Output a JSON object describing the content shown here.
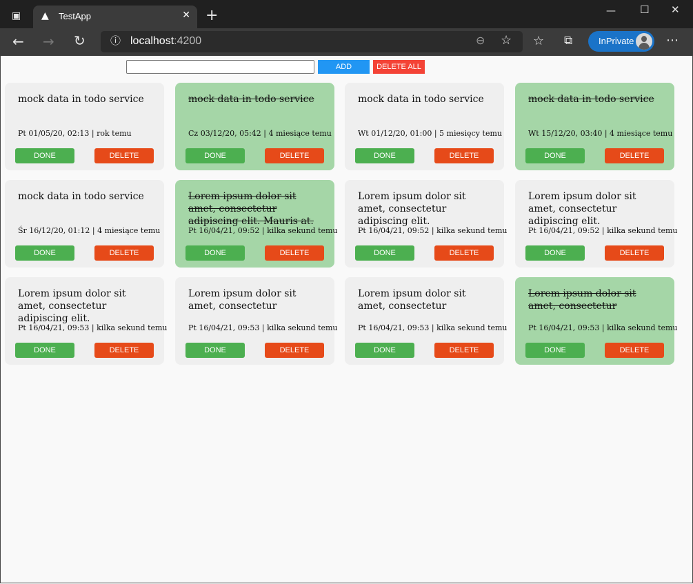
{
  "browser": {
    "tab_title": "TestApp",
    "tab_close": "✕",
    "new_tab": "+",
    "url_host": "localhost",
    "url_port": ":4200",
    "inprivate_label": "InPrivate",
    "window_controls": {
      "minimize": "—",
      "maximize": "☐",
      "close": "✕"
    }
  },
  "form": {
    "input_value": "",
    "add_label": "ADD",
    "delete_all_label": "DELETE ALL"
  },
  "colors": {
    "card": "#efefef",
    "card_done": "#a5d6a7",
    "done_button": "#4caf50",
    "delete_button": "#e64a19",
    "add_button": "#2196f3",
    "delete_all_button": "#f44336"
  },
  "todos": [
    {
      "text": "mock data in todo service",
      "meta": "Pt 01/05/20, 02:13 | rok temu",
      "done": false,
      "done_label": "DONE",
      "delete_label": "DELETE"
    },
    {
      "text": "mock data in todo service",
      "meta": "Cz 03/12/20, 05:42 | 4 miesiące temu",
      "done": true,
      "done_label": "DONE",
      "delete_label": "DELETE"
    },
    {
      "text": "mock data in todo service",
      "meta": "Wt 01/12/20, 01:00 | 5 miesięcy temu",
      "done": false,
      "done_label": "DONE",
      "delete_label": "DELETE"
    },
    {
      "text": "mock data in todo service",
      "meta": "Wt 15/12/20, 03:40 | 4 miesiące temu",
      "done": true,
      "done_label": "DONE",
      "delete_label": "DELETE"
    },
    {
      "text": "mock data in todo service",
      "meta": "Śr 16/12/20, 01:12 | 4 miesiące temu",
      "done": false,
      "done_label": "DONE",
      "delete_label": "DELETE"
    },
    {
      "text": "Lorem ipsum dolor sit amet, consectetur adipiscing elit. Mauris at.",
      "meta": "Pt 16/04/21, 09:52 | kilka sekund temu",
      "done": true,
      "done_label": "DONE",
      "delete_label": "DELETE"
    },
    {
      "text": "Lorem ipsum dolor sit amet, consectetur adipiscing elit.",
      "meta": "Pt 16/04/21, 09:52 | kilka sekund temu",
      "done": false,
      "done_label": "DONE",
      "delete_label": "DELETE"
    },
    {
      "text": "Lorem ipsum dolor sit amet, consectetur adipiscing elit.",
      "meta": "Pt 16/04/21, 09:52 | kilka sekund temu",
      "done": false,
      "done_label": "DONE",
      "delete_label": "DELETE"
    },
    {
      "text": "Lorem ipsum dolor sit amet, consectetur adipiscing elit.",
      "meta": "Pt 16/04/21, 09:53 | kilka sekund temu",
      "done": false,
      "done_label": "DONE",
      "delete_label": "DELETE"
    },
    {
      "text": "Lorem ipsum dolor sit amet, consectetur",
      "meta": "Pt 16/04/21, 09:53 | kilka sekund temu",
      "done": false,
      "done_label": "DONE",
      "delete_label": "DELETE"
    },
    {
      "text": "Lorem ipsum dolor sit amet, consectetur",
      "meta": "Pt 16/04/21, 09:53 | kilka sekund temu",
      "done": false,
      "done_label": "DONE",
      "delete_label": "DELETE"
    },
    {
      "text": "Lorem ipsum dolor sit amet, consectetur",
      "meta": "Pt 16/04/21, 09:53 | kilka sekund temu",
      "done": true,
      "done_label": "DONE",
      "delete_label": "DELETE"
    }
  ]
}
